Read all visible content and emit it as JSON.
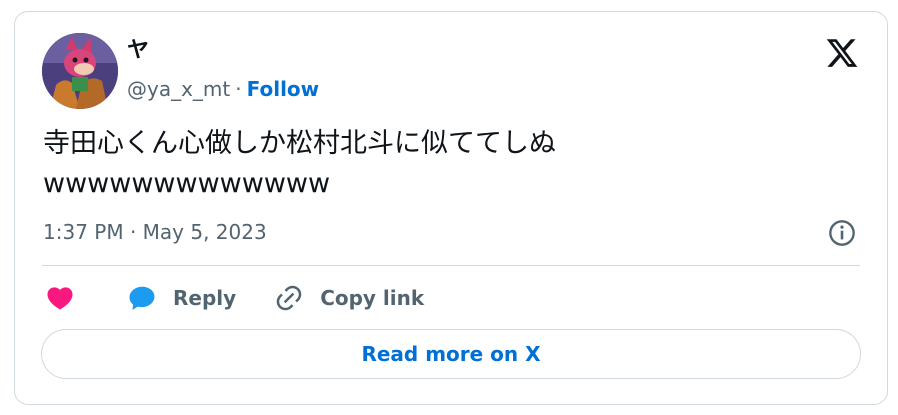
{
  "author": {
    "display_name": "ヤ",
    "handle": "@ya_x_mt",
    "separator": "·",
    "follow_label": "Follow",
    "avatar_icon": "profile-avatar"
  },
  "tweet": {
    "text": "寺田心くん心做しか松村北斗に似ててしぬ\nwwwwwwwwwwwww",
    "timestamp": "1:37 PM · May 5, 2023"
  },
  "actions": {
    "like_icon": "heart-icon",
    "reply_label": "Reply",
    "copy_link_label": "Copy link"
  },
  "read_more_label": "Read more on X",
  "colors": {
    "link": "#006fd6",
    "like": "#f91880",
    "reply_icon": "#1d9bf0",
    "muted": "#536471",
    "border": "#cfd9de"
  }
}
